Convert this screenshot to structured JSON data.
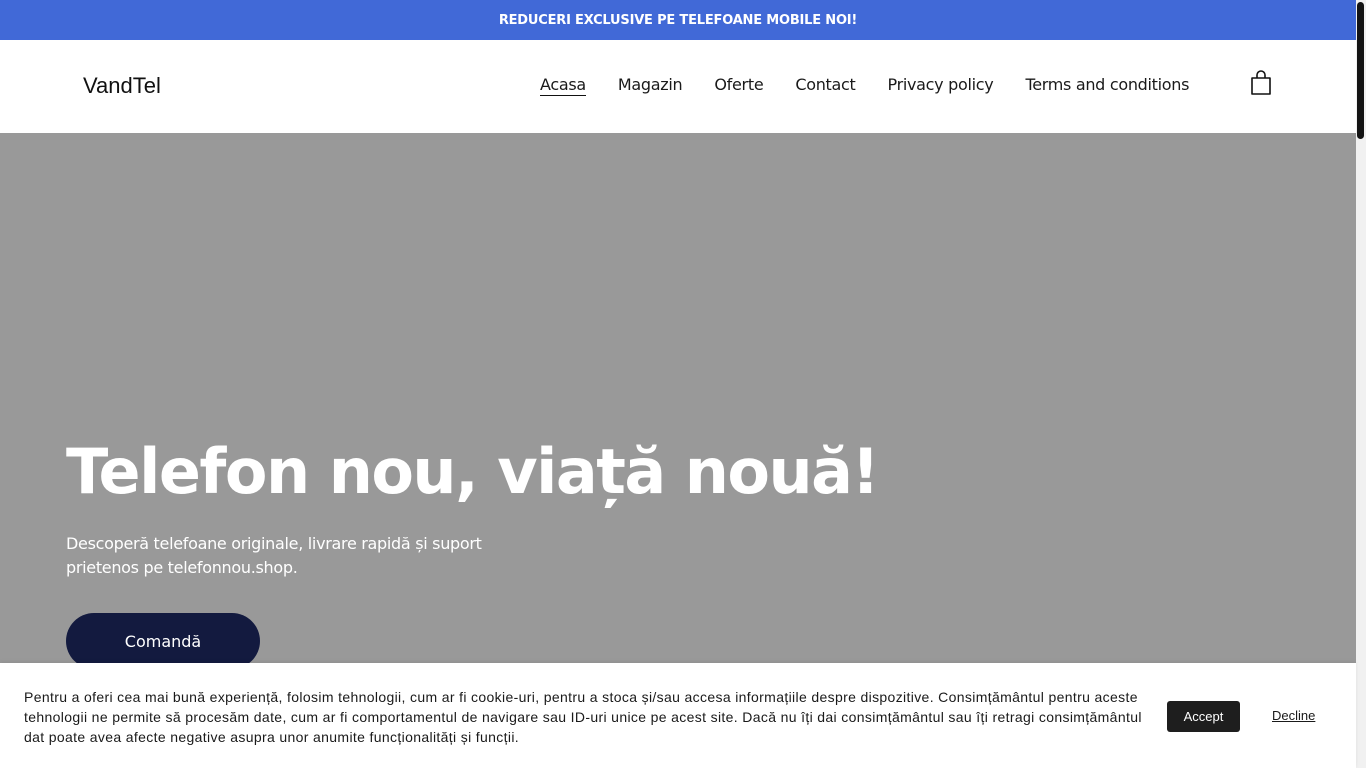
{
  "announcement": {
    "text": "REDUCERI EXCLUSIVE PE TELEFOANE MOBILE NOI!"
  },
  "header": {
    "logo": "VandTel",
    "nav": [
      {
        "label": "Acasa",
        "active": true
      },
      {
        "label": "Magazin",
        "active": false
      },
      {
        "label": "Oferte",
        "active": false
      },
      {
        "label": "Contact",
        "active": false
      },
      {
        "label": "Privacy policy",
        "active": false
      },
      {
        "label": "Terms and conditions",
        "active": false
      }
    ],
    "cart_icon": "shopping-bag-icon"
  },
  "hero": {
    "title": "Telefon nou, viață nouă!",
    "subtitle": "Descoperă telefoane originale, livrare rapidă și suport prietenos pe telefonnou.shop.",
    "button": "Comandă",
    "colors": {
      "background": "#999999",
      "button": "#131a3f"
    }
  },
  "cookie_banner": {
    "text": "Pentru a oferi cea mai bună experiență, folosim tehnologii, cum ar fi cookie-uri, pentru a stoca și/sau accesa informațiile despre dispozitive. Consimțământul pentru aceste tehnologii ne permite să procesăm date, cum ar fi comportamentul de navigare sau ID-uri unice pe acest site. Dacă nu îți dai consimțământul sau îți retragi consimțământul dat poate avea afecte negative asupra unor anumite funcționalități și funcții.",
    "accept": "Accept",
    "decline": "Decline"
  },
  "colors": {
    "accent": "#4169d7",
    "dark": "#1e1e1e"
  }
}
